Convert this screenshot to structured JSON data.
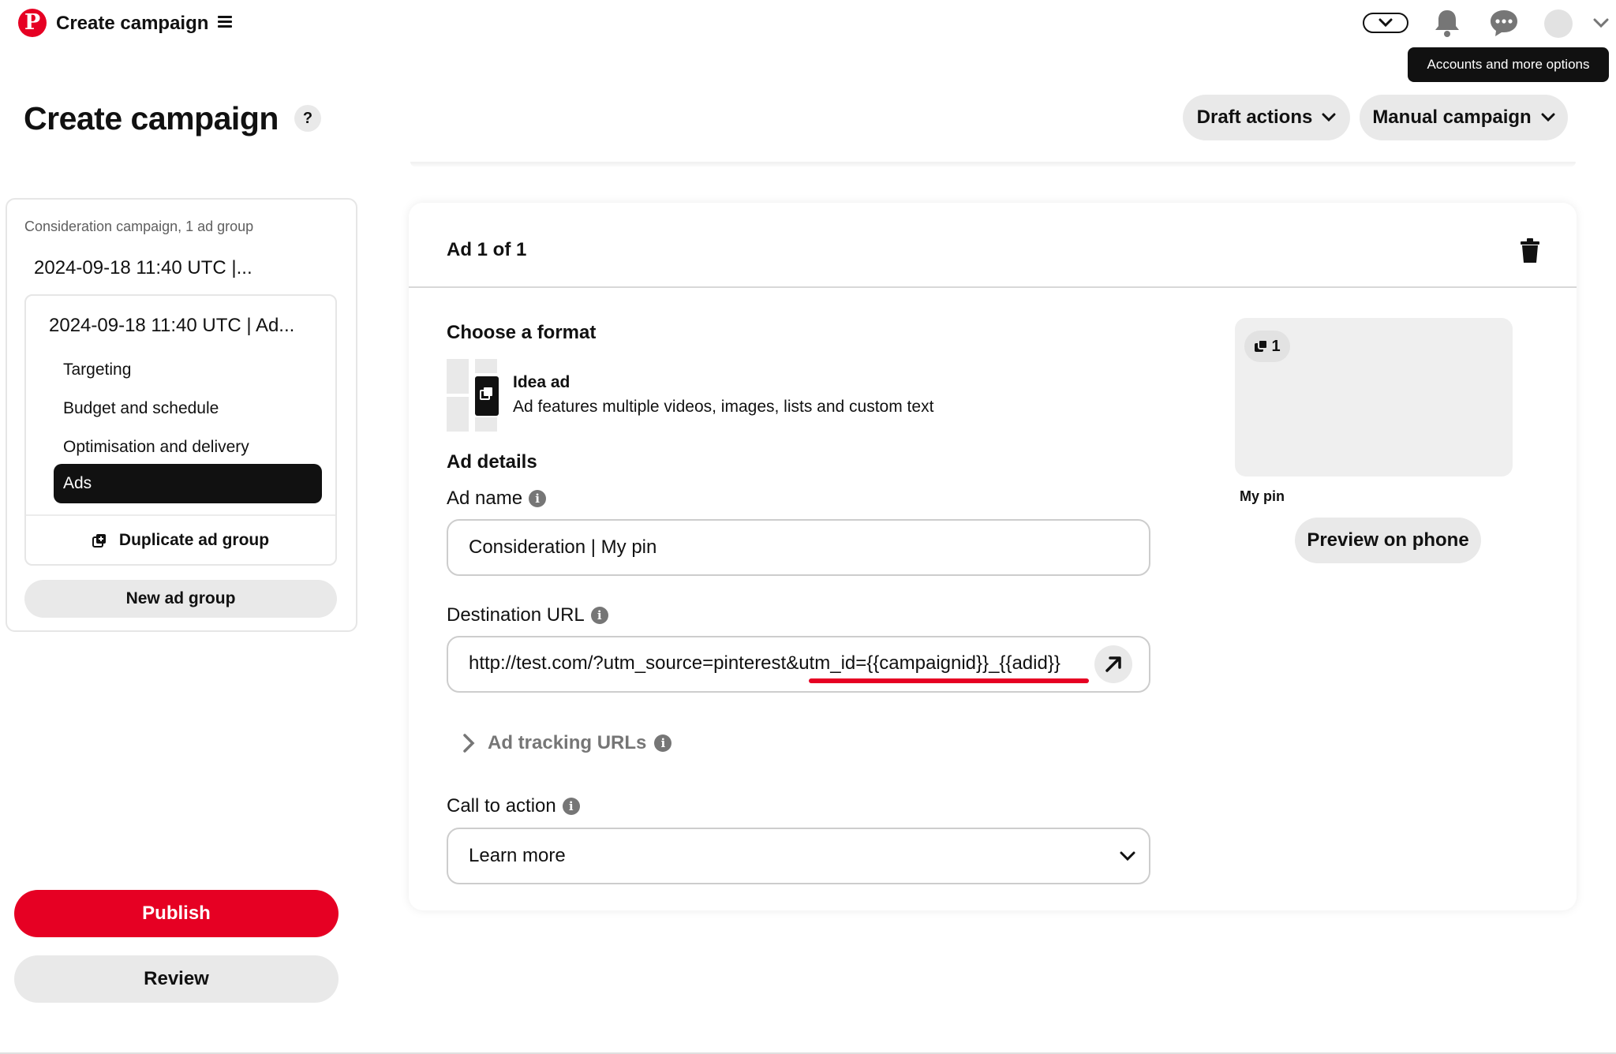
{
  "header": {
    "app_title": "Create campaign",
    "tooltip": "Accounts and more options"
  },
  "page": {
    "title": "Create campaign",
    "help": "?",
    "draft_actions": "Draft actions",
    "manual_campaign": "Manual campaign"
  },
  "sidebar": {
    "campaign_subtitle": "Consideration campaign, 1 ad group",
    "campaign_name": "2024-09-18 11:40 UTC |...",
    "ad_group_name": "2024-09-18 11:40 UTC | Ad...",
    "nav": [
      {
        "label": "Targeting"
      },
      {
        "label": "Budget and schedule"
      },
      {
        "label": "Optimisation and delivery"
      },
      {
        "label": "Ads",
        "active": true
      }
    ],
    "duplicate_label": "Duplicate ad group",
    "new_group_label": "New ad group",
    "publish_label": "Publish",
    "review_label": "Review"
  },
  "ad": {
    "title": "Ad 1 of 1",
    "choose_format": "Choose a format",
    "format_title": "Idea ad",
    "format_desc": "Ad features multiple videos, images, lists and custom text",
    "details_heading": "Ad details",
    "ad_name_label": "Ad name",
    "ad_name_value": "Consideration | My pin",
    "destination_label": "Destination URL",
    "destination_value": "http://test.com/?utm_source=pinterest&utm_id={{campaignid}}_{{adid}}",
    "tracking_label": "Ad tracking URLs",
    "cta_label": "Call to action",
    "cta_value": "Learn more"
  },
  "preview": {
    "page_count": "1",
    "caption": "My pin",
    "preview_button": "Preview on phone"
  },
  "colors": {
    "brand_red": "#e60023",
    "active_nav": "#111111",
    "pill_gray": "#e9e9e9"
  }
}
